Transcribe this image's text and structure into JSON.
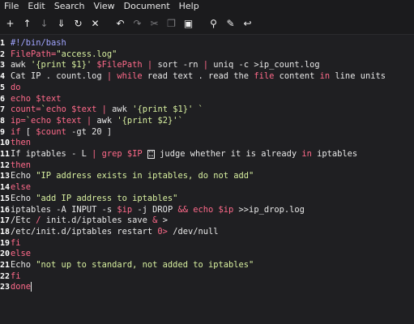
{
  "menu": [
    "File",
    "Edit",
    "Search",
    "View",
    "Document",
    "Help"
  ],
  "toolbar": [
    {
      "name": "new-file-icon",
      "glyph": "+",
      "dim": false
    },
    {
      "name": "open-file-icon",
      "glyph": "↑",
      "dim": false
    },
    {
      "name": "save-file-icon",
      "glyph": "↓",
      "dim": true
    },
    {
      "name": "save-as-icon",
      "glyph": "⇓",
      "dim": false
    },
    {
      "name": "reload-icon",
      "glyph": "↻",
      "dim": false
    },
    {
      "name": "close-icon",
      "glyph": "✕",
      "dim": false
    },
    {
      "name": "undo-icon",
      "glyph": "↶",
      "dim": false
    },
    {
      "name": "redo-icon",
      "glyph": "↷",
      "dim": true
    },
    {
      "name": "cut-icon",
      "glyph": "✂",
      "dim": true
    },
    {
      "name": "copy-icon",
      "glyph": "❐",
      "dim": true
    },
    {
      "name": "paste-icon",
      "glyph": "▣",
      "dim": false
    },
    {
      "name": "search-icon",
      "glyph": "⚲",
      "dim": false
    },
    {
      "name": "find-replace-icon",
      "glyph": "✎",
      "dim": false
    },
    {
      "name": "goto-icon",
      "glyph": "↩",
      "dim": false
    }
  ],
  "code_lines": [
    {
      "n": "1",
      "tokens": [
        {
          "t": "#!/bin/bash",
          "c": "cm"
        }
      ]
    },
    {
      "n": "2",
      "tokens": [
        {
          "t": "FilePath=",
          "c": "var"
        },
        {
          "t": "\"access.log\"",
          "c": "str"
        }
      ]
    },
    {
      "n": "3",
      "tokens": [
        {
          "t": "awk ",
          "c": "pl"
        },
        {
          "t": "'{print $1}'",
          "c": "str"
        },
        {
          "t": " $FilePath",
          "c": "var"
        },
        {
          "t": " | ",
          "c": "op"
        },
        {
          "t": "sort -rn ",
          "c": "pl"
        },
        {
          "t": "| ",
          "c": "op"
        },
        {
          "t": "uniq -c ",
          "c": "pl"
        },
        {
          "t": ">ip_count.log",
          "c": "pl"
        }
      ]
    },
    {
      "n": "4",
      "tokens": [
        {
          "t": "Cat IP . count.log ",
          "c": "pl"
        },
        {
          "t": "| ",
          "c": "op"
        },
        {
          "t": "while ",
          "c": "kw"
        },
        {
          "t": "read ",
          "c": "pl"
        },
        {
          "t": "text . ",
          "c": "pl"
        },
        {
          "t": "read ",
          "c": "pl"
        },
        {
          "t": "the ",
          "c": "pl"
        },
        {
          "t": "file ",
          "c": "kw"
        },
        {
          "t": "content ",
          "c": "pl"
        },
        {
          "t": "in ",
          "c": "kw"
        },
        {
          "t": "line units",
          "c": "pl"
        }
      ]
    },
    {
      "n": "5",
      "tokens": [
        {
          "t": "do",
          "c": "kw"
        }
      ]
    },
    {
      "n": "6",
      "tokens": [
        {
          "t": "echo ",
          "c": "kw"
        },
        {
          "t": "$text",
          "c": "var"
        }
      ]
    },
    {
      "n": "7",
      "tokens": [
        {
          "t": "count=",
          "c": "var"
        },
        {
          "t": "`",
          "c": "str"
        },
        {
          "t": "echo ",
          "c": "kw"
        },
        {
          "t": "$text ",
          "c": "var"
        },
        {
          "t": "| ",
          "c": "op"
        },
        {
          "t": "awk ",
          "c": "pl"
        },
        {
          "t": "'{print $1}'",
          "c": "str"
        },
        {
          "t": " `",
          "c": "str"
        }
      ]
    },
    {
      "n": "8",
      "tokens": [
        {
          "t": "ip=",
          "c": "var"
        },
        {
          "t": "`",
          "c": "str"
        },
        {
          "t": "echo ",
          "c": "kw"
        },
        {
          "t": "$text ",
          "c": "var"
        },
        {
          "t": "| ",
          "c": "op"
        },
        {
          "t": "awk ",
          "c": "pl"
        },
        {
          "t": "'{print $2}'",
          "c": "str"
        },
        {
          "t": "`",
          "c": "str"
        }
      ]
    },
    {
      "n": "9",
      "tokens": [
        {
          "t": "if ",
          "c": "kw"
        },
        {
          "t": "[ ",
          "c": "pl"
        },
        {
          "t": "$count ",
          "c": "var"
        },
        {
          "t": "-gt 20 ]",
          "c": "pl"
        }
      ]
    },
    {
      "n": "10",
      "tokens": [
        {
          "t": "then",
          "c": "kw"
        }
      ]
    },
    {
      "n": "11",
      "tokens": [
        {
          "t": "If iptables - L ",
          "c": "pl"
        },
        {
          "t": "| ",
          "c": "op"
        },
        {
          "t": "grep ",
          "c": "kw"
        },
        {
          "t": "$IP ",
          "c": "var"
        },
        {
          "t": "[box]",
          "c": "box"
        },
        {
          "t": " judge whether it is already ",
          "c": "pl"
        },
        {
          "t": "in ",
          "c": "kw"
        },
        {
          "t": "iptables",
          "c": "pl"
        }
      ]
    },
    {
      "n": "12",
      "tokens": [
        {
          "t": "then",
          "c": "kw"
        }
      ]
    },
    {
      "n": "13",
      "tokens": [
        {
          "t": "Echo ",
          "c": "pl"
        },
        {
          "t": "\"IP address exists in iptables, do not add\"",
          "c": "str"
        }
      ]
    },
    {
      "n": "14",
      "tokens": [
        {
          "t": "else",
          "c": "kw"
        }
      ]
    },
    {
      "n": "15",
      "tokens": [
        {
          "t": "Echo ",
          "c": "pl"
        },
        {
          "t": "\"add IP address to iptables\"",
          "c": "str"
        }
      ]
    },
    {
      "n": "16",
      "tokens": [
        {
          "t": "iptables -A INPUT -s ",
          "c": "pl"
        },
        {
          "t": "$ip ",
          "c": "var"
        },
        {
          "t": "-j DROP ",
          "c": "pl"
        },
        {
          "t": "&& ",
          "c": "op"
        },
        {
          "t": "echo ",
          "c": "kw"
        },
        {
          "t": "$ip ",
          "c": "var"
        },
        {
          "t": ">>ip_drop.log",
          "c": "pl"
        }
      ]
    },
    {
      "n": "17",
      "tokens": [
        {
          "t": "/Etc ",
          "c": "pl"
        },
        {
          "t": "/ ",
          "c": "op"
        },
        {
          "t": "init.d/iptables save ",
          "c": "pl"
        },
        {
          "t": "& ",
          "c": "op"
        },
        {
          "t": ">",
          "c": "pl"
        }
      ]
    },
    {
      "n": "18",
      "tokens": [
        {
          "t": "/etc/init.d/iptables restart ",
          "c": "pl"
        },
        {
          "t": "0> ",
          "c": "op"
        },
        {
          "t": "/dev/null",
          "c": "pl"
        }
      ]
    },
    {
      "n": "19",
      "tokens": [
        {
          "t": "fi",
          "c": "kw"
        }
      ]
    },
    {
      "n": "20",
      "tokens": [
        {
          "t": "else",
          "c": "kw"
        }
      ]
    },
    {
      "n": "21",
      "tokens": [
        {
          "t": "Echo ",
          "c": "pl"
        },
        {
          "t": "\"not up to standard, not added to iptables\"",
          "c": "str"
        }
      ]
    },
    {
      "n": "22",
      "tokens": [
        {
          "t": "fi",
          "c": "kw"
        }
      ]
    },
    {
      "n": "23",
      "tokens": [
        {
          "t": "done",
          "c": "kw"
        },
        {
          "t": "[cursor]",
          "c": "cursor"
        }
      ]
    }
  ]
}
